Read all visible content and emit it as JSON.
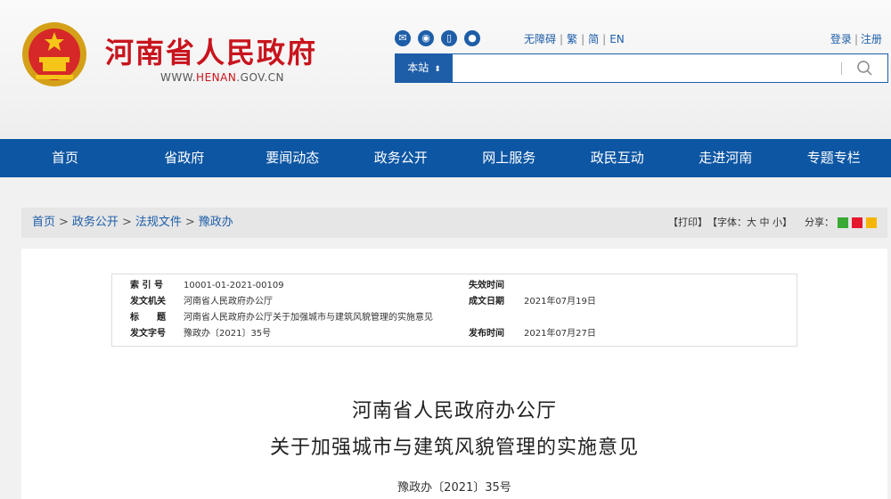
{
  "header": {
    "site_title": "河南省人民政府",
    "site_url_prefix": "WWW.",
    "site_url_brand": "HENAN",
    "site_url_suffix": ".GOV.CN",
    "top_links": [
      "无障碍",
      "繁",
      "简",
      "EN"
    ],
    "account": {
      "login": "登录",
      "register": "注册"
    },
    "search": {
      "scope_label": "本站",
      "placeholder": ""
    }
  },
  "social_icons": [
    "wechat-icon",
    "weibo-icon",
    "mobile-icon",
    "app-icon"
  ],
  "nav": [
    "首页",
    "省政府",
    "要闻动态",
    "政务公开",
    "网上服务",
    "政民互动",
    "走进河南",
    "专题专栏"
  ],
  "breadcrumb": [
    "首页",
    "政务公开",
    "法规文件",
    "豫政办"
  ],
  "tools": {
    "print": "【打印】",
    "font_label": "【字体：",
    "font_large": "大",
    "font_medium": "中",
    "font_small": "小",
    "font_close": "】",
    "share_label": "分享："
  },
  "meta": {
    "index_label": "索 引 号",
    "index_value": "10001-01-2021-00109",
    "expiry_label": "失效时间",
    "expiry_value": "",
    "issuer_label": "发文机关",
    "issuer_value": "河南省人民政府办公厅",
    "written_label": "成文日期",
    "written_value": "2021年07月19日",
    "title_label": "标　　题",
    "title_value": "河南省人民政府办公厅关于加强城市与建筑风貌管理的实施意见",
    "docno_label": "发文字号",
    "docno_value": "豫政办〔2021〕35号",
    "publish_label": "发布时间",
    "publish_value": "2021年07月27日"
  },
  "document": {
    "title_line1": "河南省人民政府办公厅",
    "title_line2": "关于加强城市与建筑风貌管理的实施意见",
    "number": "豫政办〔2021〕35号"
  },
  "colors": {
    "brand_red": "#c8141d",
    "nav_blue": "#0d56a3",
    "link_blue": "#1e5ea8"
  }
}
